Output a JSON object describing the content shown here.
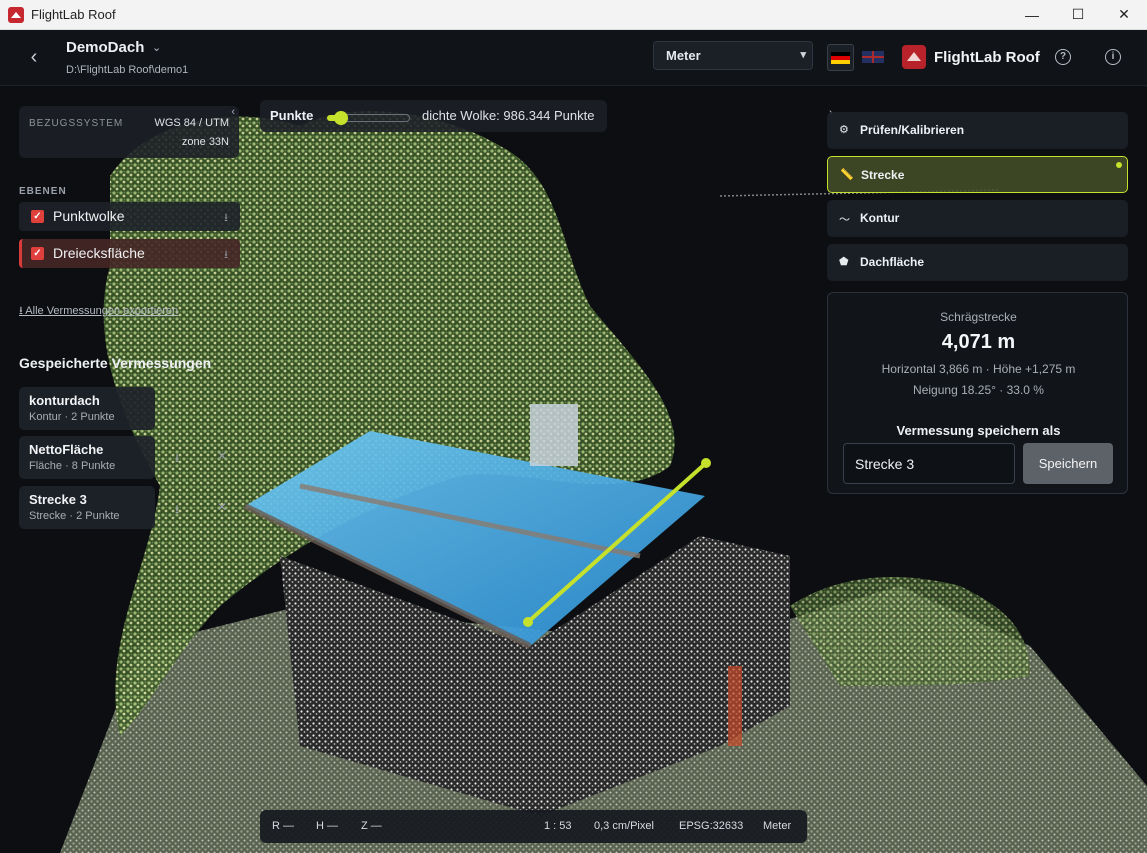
{
  "window": {
    "title": "FlightLab Roof",
    "controls": [
      "—",
      "☐",
      "✕"
    ]
  },
  "header": {
    "project_name": "DemoDach",
    "project_path": "D:\\FlightLab Roof\\demo1",
    "unit_selected": "Meter",
    "brand": "FlightLab Roof",
    "help": "?",
    "info": "i"
  },
  "reference": {
    "label": "BEZUGSSYSTEM",
    "value1": "WGS 84 / UTM",
    "value2": "zone 33N"
  },
  "layers": {
    "section_title": "EBENEN",
    "items": [
      {
        "label": "Punktwolke"
      },
      {
        "label": "Dreiecksfläche"
      }
    ]
  },
  "export_link": "⭳ Alle Vermessungen exportieren",
  "saved": {
    "section_title": "Gespeicherte Vermessungen",
    "items": [
      {
        "name": "konturdach",
        "meta": "Kontur · 2 Punkte"
      },
      {
        "name": "NettoFläche",
        "meta": "Fläche · 8 Punkte"
      },
      {
        "name": "Strecke 3",
        "meta": "Strecke · 2 Punkte"
      }
    ]
  },
  "points_control": {
    "label": "Punkte",
    "count_text": "dichte Wolke: 986.344 Punkte",
    "level": 0.05
  },
  "tools": [
    {
      "label": "Prüfen/Kalibrieren",
      "icon": "calibrate-icon"
    },
    {
      "label": "Strecke",
      "icon": "ruler-icon",
      "active": true
    },
    {
      "label": "Kontur",
      "icon": "contour-icon"
    },
    {
      "label": "Dachfläche",
      "icon": "roof-area-icon"
    }
  ],
  "measurement": {
    "label": "Schrägstrecke",
    "value": "4,071 m",
    "line1": "Horizontal 3,866 m · Höhe +1,275 m",
    "line2": "Neigung 18.25° · 33.0 %",
    "save_as_label": "Vermessung speichern als",
    "save_input_value": "Strecke 3",
    "save_button": "Speichern"
  },
  "status": {
    "r": "R —",
    "h": "H —",
    "z": "Z —",
    "scale": "1 : 53",
    "resolution": "0,3 cm/Pixel",
    "epsg": "EPSG:32633",
    "unit": "Meter"
  },
  "colors": {
    "accent": "#c6e12c",
    "brand": "#c7272e",
    "roof": "#49aee6"
  }
}
